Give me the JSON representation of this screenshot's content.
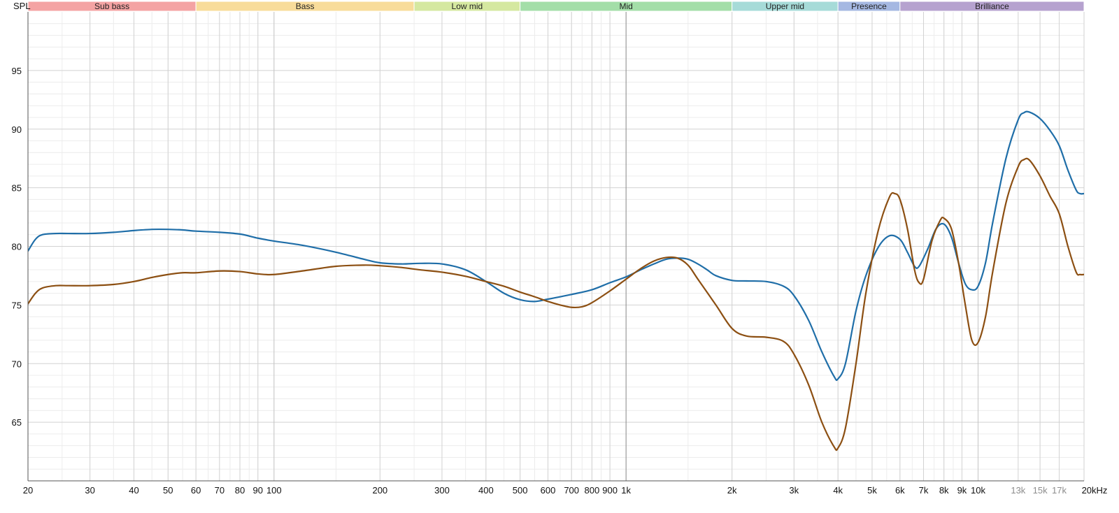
{
  "chart_data": {
    "type": "line",
    "y_axis_label": "SPL",
    "x_unit_label": "kHz",
    "x_scale": "log",
    "xlim": [
      20,
      20000
    ],
    "ylim": [
      60,
      100
    ],
    "grid": true,
    "y_ticks": [
      {
        "value": 65,
        "label": "65"
      },
      {
        "value": 70,
        "label": "70"
      },
      {
        "value": 75,
        "label": "75"
      },
      {
        "value": 80,
        "label": "80"
      },
      {
        "value": 85,
        "label": "85"
      },
      {
        "value": 90,
        "label": "90"
      },
      {
        "value": 95,
        "label": "95"
      }
    ],
    "x_ticks": [
      {
        "value": 20,
        "label": "20"
      },
      {
        "value": 30,
        "label": "30"
      },
      {
        "value": 40,
        "label": "40"
      },
      {
        "value": 50,
        "label": "50"
      },
      {
        "value": 60,
        "label": "60"
      },
      {
        "value": 70,
        "label": "70"
      },
      {
        "value": 80,
        "label": "80"
      },
      {
        "value": 90,
        "label": "90"
      },
      {
        "value": 100,
        "label": "100"
      },
      {
        "value": 200,
        "label": "200"
      },
      {
        "value": 300,
        "label": "300"
      },
      {
        "value": 400,
        "label": "400"
      },
      {
        "value": 500,
        "label": "500"
      },
      {
        "value": 600,
        "label": "600"
      },
      {
        "value": 700,
        "label": "700"
      },
      {
        "value": 800,
        "label": "800"
      },
      {
        "value": 900,
        "label": "900"
      },
      {
        "value": 1000,
        "label": "1k"
      },
      {
        "value": 2000,
        "label": "2k"
      },
      {
        "value": 3000,
        "label": "3k"
      },
      {
        "value": 4000,
        "label": "4k"
      },
      {
        "value": 5000,
        "label": "5k"
      },
      {
        "value": 6000,
        "label": "6k"
      },
      {
        "value": 7000,
        "label": "7k"
      },
      {
        "value": 8000,
        "label": "8k"
      },
      {
        "value": 9000,
        "label": "9k"
      },
      {
        "value": 10000,
        "label": "10k"
      },
      {
        "value": 13000,
        "label": "13k",
        "muted": true
      },
      {
        "value": 15000,
        "label": "15k",
        "muted": true
      },
      {
        "value": 17000,
        "label": "17k",
        "muted": true
      },
      {
        "value": 20000,
        "label": "20kHz"
      }
    ],
    "bands": [
      {
        "label": "Sub bass",
        "from": 20,
        "to": 60,
        "color": "#f4a3a3"
      },
      {
        "label": "Bass",
        "from": 60,
        "to": 250,
        "color": "#f8dc9a"
      },
      {
        "label": "Low mid",
        "from": 250,
        "to": 500,
        "color": "#d5e8a0"
      },
      {
        "label": "Mid",
        "from": 500,
        "to": 2000,
        "color": "#a3dea8"
      },
      {
        "label": "Upper mid",
        "from": 2000,
        "to": 4000,
        "color": "#a6dbd8"
      },
      {
        "label": "Presence",
        "from": 4000,
        "to": 6000,
        "color": "#a5b8e2"
      },
      {
        "label": "Brilliance",
        "from": 6000,
        "to": 20000,
        "color": "#b6a2cf"
      }
    ],
    "series": [
      {
        "color": "#1f6ea8",
        "points": [
          [
            20,
            79.6
          ],
          [
            21,
            80.6
          ],
          [
            22,
            81.0
          ],
          [
            24,
            81.1
          ],
          [
            26,
            81.1
          ],
          [
            30,
            81.1
          ],
          [
            35,
            81.2
          ],
          [
            40,
            81.35
          ],
          [
            45,
            81.45
          ],
          [
            50,
            81.45
          ],
          [
            55,
            81.4
          ],
          [
            60,
            81.3
          ],
          [
            70,
            81.2
          ],
          [
            80,
            81.05
          ],
          [
            90,
            80.7
          ],
          [
            100,
            80.45
          ],
          [
            120,
            80.1
          ],
          [
            150,
            79.5
          ],
          [
            180,
            78.9
          ],
          [
            200,
            78.6
          ],
          [
            230,
            78.5
          ],
          [
            260,
            78.55
          ],
          [
            300,
            78.5
          ],
          [
            350,
            78.0
          ],
          [
            400,
            77.0
          ],
          [
            450,
            76.0
          ],
          [
            500,
            75.45
          ],
          [
            550,
            75.3
          ],
          [
            600,
            75.5
          ],
          [
            700,
            75.9
          ],
          [
            800,
            76.3
          ],
          [
            900,
            76.9
          ],
          [
            1000,
            77.4
          ],
          [
            1100,
            78.0
          ],
          [
            1200,
            78.5
          ],
          [
            1300,
            78.9
          ],
          [
            1400,
            79.0
          ],
          [
            1500,
            78.9
          ],
          [
            1600,
            78.5
          ],
          [
            1700,
            78.0
          ],
          [
            1800,
            77.5
          ],
          [
            2000,
            77.1
          ],
          [
            2200,
            77.05
          ],
          [
            2500,
            77.0
          ],
          [
            2800,
            76.6
          ],
          [
            3000,
            75.8
          ],
          [
            3300,
            73.7
          ],
          [
            3600,
            71.0
          ],
          [
            3900,
            68.9
          ],
          [
            4000,
            68.7
          ],
          [
            4200,
            70.0
          ],
          [
            4500,
            74.5
          ],
          [
            4800,
            77.5
          ],
          [
            5200,
            79.9
          ],
          [
            5600,
            80.9
          ],
          [
            6000,
            80.6
          ],
          [
            6300,
            79.5
          ],
          [
            6600,
            78.3
          ],
          [
            6800,
            78.3
          ],
          [
            7200,
            79.8
          ],
          [
            7600,
            81.5
          ],
          [
            8000,
            81.9
          ],
          [
            8400,
            80.8
          ],
          [
            8800,
            78.6
          ],
          [
            9200,
            76.8
          ],
          [
            9600,
            76.3
          ],
          [
            10000,
            76.6
          ],
          [
            10500,
            78.6
          ],
          [
            11000,
            82.0
          ],
          [
            12000,
            87.5
          ],
          [
            13000,
            90.8
          ],
          [
            13500,
            91.4
          ],
          [
            14000,
            91.45
          ],
          [
            15000,
            90.9
          ],
          [
            16000,
            89.9
          ],
          [
            17000,
            88.6
          ],
          [
            18000,
            86.5
          ],
          [
            19000,
            84.8
          ],
          [
            19500,
            84.5
          ],
          [
            20000,
            84.5
          ]
        ]
      },
      {
        "color": "#8c4f12",
        "points": [
          [
            20,
            75.1
          ],
          [
            21,
            76.0
          ],
          [
            22,
            76.45
          ],
          [
            24,
            76.65
          ],
          [
            26,
            76.65
          ],
          [
            30,
            76.65
          ],
          [
            35,
            76.75
          ],
          [
            40,
            77.0
          ],
          [
            45,
            77.35
          ],
          [
            50,
            77.6
          ],
          [
            55,
            77.75
          ],
          [
            60,
            77.75
          ],
          [
            70,
            77.9
          ],
          [
            80,
            77.85
          ],
          [
            90,
            77.65
          ],
          [
            100,
            77.6
          ],
          [
            120,
            77.9
          ],
          [
            150,
            78.3
          ],
          [
            180,
            78.4
          ],
          [
            200,
            78.35
          ],
          [
            230,
            78.2
          ],
          [
            260,
            78.0
          ],
          [
            300,
            77.8
          ],
          [
            350,
            77.45
          ],
          [
            400,
            77.0
          ],
          [
            450,
            76.6
          ],
          [
            500,
            76.1
          ],
          [
            550,
            75.7
          ],
          [
            600,
            75.3
          ],
          [
            650,
            75.0
          ],
          [
            700,
            74.8
          ],
          [
            750,
            74.85
          ],
          [
            800,
            75.2
          ],
          [
            900,
            76.2
          ],
          [
            1000,
            77.2
          ],
          [
            1100,
            78.1
          ],
          [
            1200,
            78.75
          ],
          [
            1300,
            79.05
          ],
          [
            1400,
            79.0
          ],
          [
            1500,
            78.4
          ],
          [
            1600,
            77.2
          ],
          [
            1800,
            75.0
          ],
          [
            2000,
            73.0
          ],
          [
            2200,
            72.35
          ],
          [
            2500,
            72.25
          ],
          [
            2800,
            71.9
          ],
          [
            3000,
            70.8
          ],
          [
            3300,
            68.2
          ],
          [
            3600,
            65.0
          ],
          [
            3900,
            62.9
          ],
          [
            4000,
            62.8
          ],
          [
            4200,
            64.5
          ],
          [
            4500,
            70.0
          ],
          [
            4800,
            76.0
          ],
          [
            5200,
            81.3
          ],
          [
            5600,
            84.2
          ],
          [
            5800,
            84.5
          ],
          [
            6000,
            84.0
          ],
          [
            6300,
            81.5
          ],
          [
            6600,
            78.0
          ],
          [
            6800,
            76.9
          ],
          [
            7000,
            77.2
          ],
          [
            7400,
            80.5
          ],
          [
            7800,
            82.2
          ],
          [
            8000,
            82.4
          ],
          [
            8400,
            81.5
          ],
          [
            8800,
            78.6
          ],
          [
            9200,
            75.0
          ],
          [
            9600,
            72.0
          ],
          [
            10000,
            71.8
          ],
          [
            10500,
            74.0
          ],
          [
            11000,
            77.8
          ],
          [
            12000,
            83.7
          ],
          [
            13000,
            86.8
          ],
          [
            13500,
            87.4
          ],
          [
            14000,
            87.35
          ],
          [
            15000,
            86.0
          ],
          [
            16000,
            84.3
          ],
          [
            17000,
            82.8
          ],
          [
            18000,
            80.0
          ],
          [
            19000,
            77.8
          ],
          [
            19500,
            77.6
          ],
          [
            20000,
            77.6
          ]
        ]
      }
    ]
  }
}
